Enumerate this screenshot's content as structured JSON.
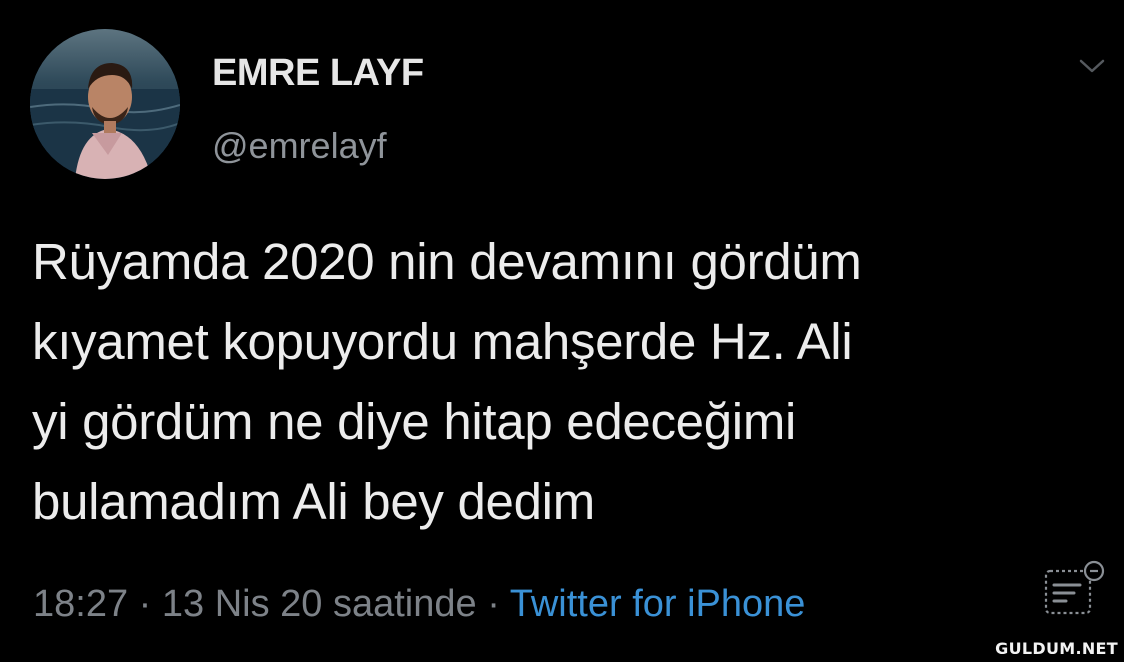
{
  "tweet": {
    "author": {
      "display_name": "EMRE LAYF",
      "handle": "@emrelayf",
      "avatar_icon": "profile-photo"
    },
    "text_lines": [
      "Rüyamda 2020 nin devamını gördüm",
      "kıyamet kopuyordu mahşerde Hz. Ali",
      "yi gördüm ne diye hitap edeceğimi",
      "bulamadım Ali bey dedim"
    ],
    "meta": {
      "time": "18:27",
      "date": "13 Nis 20 saatinde",
      "separator": " · ",
      "source": "Twitter for iPhone"
    },
    "icons": {
      "menu": "chevron-down-icon",
      "analytics": "analytics-icon"
    }
  },
  "watermark": "GULDUM.NET",
  "colors": {
    "background": "#000000",
    "text": "#ececec",
    "muted": "#7d8288",
    "link": "#3a91d6"
  }
}
